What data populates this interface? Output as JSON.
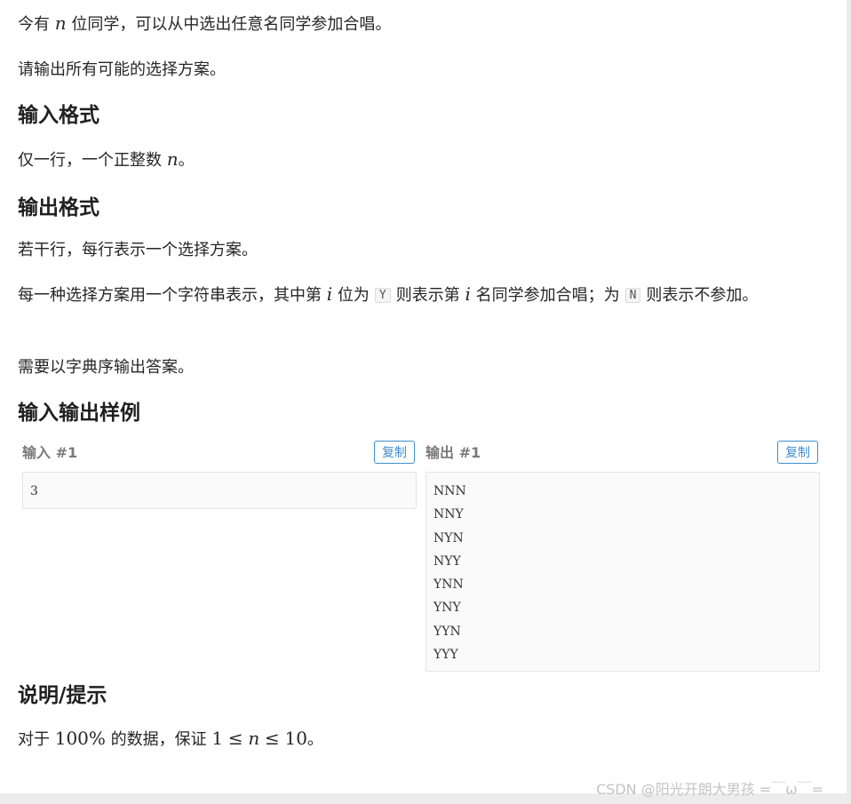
{
  "description": {
    "intro_1": [
      "今有 ",
      "n",
      " 位同学，可以从中选出任意名同学参加合唱。"
    ],
    "intro_2": "请输出所有可能的选择方案。"
  },
  "input_format": {
    "heading": "输入格式",
    "text": [
      "仅一行，一个正整数 ",
      "n",
      "。"
    ]
  },
  "output_format": {
    "heading": "输出格式",
    "text_1": "若干行，每行表示一个选择方案。",
    "text_2": [
      "每一种选择方案用一个字符串表示，其中第 ",
      "i",
      " 位为",
      "Y",
      "则表示第 ",
      "i",
      " 名同学参加合唱；为",
      "N",
      "则表示不参加。"
    ],
    "text_3": "需要以字典序输出答案。"
  },
  "samples": {
    "heading": "输入输出样例",
    "input_label": "输入 #1",
    "output_label": "输出 #1",
    "copy_label": "复制",
    "input_lines": [
      "3"
    ],
    "output_lines": [
      "NNN",
      "NNY",
      "NYN",
      "NYY",
      "YNN",
      "YNY",
      "YYN",
      "YYY"
    ]
  },
  "hint": {
    "heading": "说明/提示",
    "text": [
      "对于 ",
      "100%",
      " 的数据，保证 ",
      "1",
      "≤",
      "n",
      "≤",
      "10",
      "。"
    ]
  },
  "watermark": "CSDN @阳光开朗大男孩 =￣ω￣="
}
